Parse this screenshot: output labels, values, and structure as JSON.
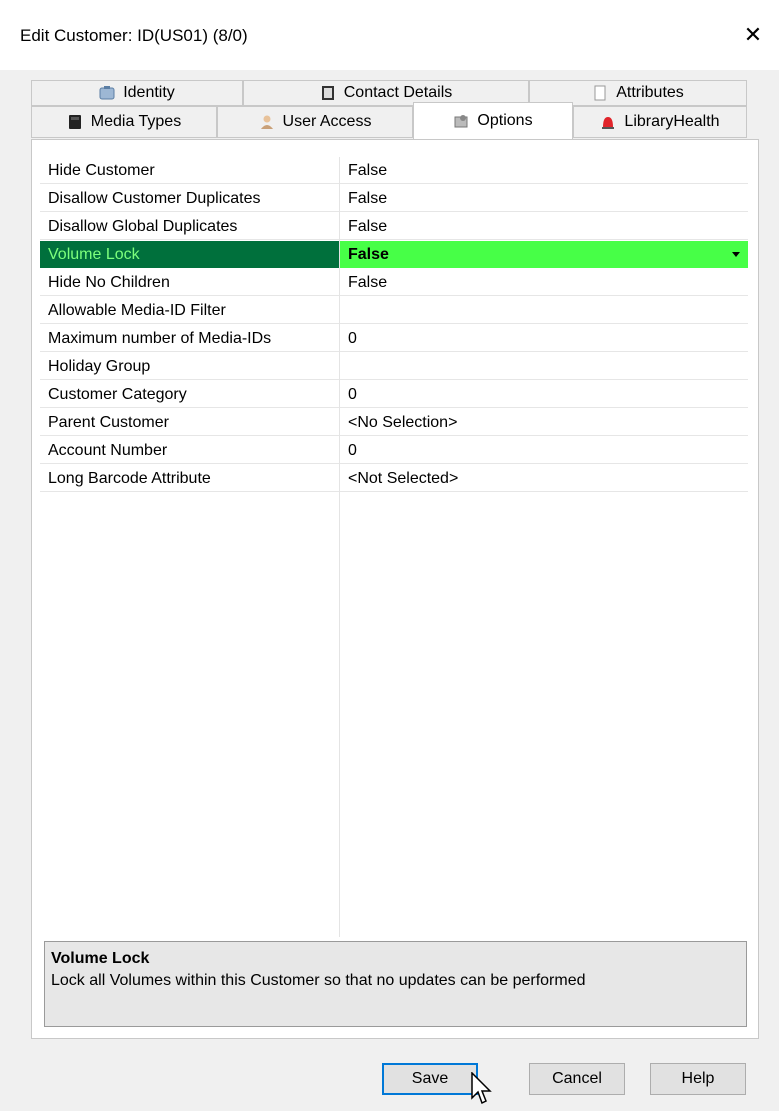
{
  "window": {
    "title": "Edit Customer: ID(US01) (8/0)",
    "close_glyph": "✕"
  },
  "tabs": {
    "row1": [
      {
        "label": "Identity",
        "icon": "identity-card-icon"
      },
      {
        "label": "Contact Details",
        "icon": "address-book-icon"
      },
      {
        "label": "Attributes",
        "icon": "attributes-icon"
      }
    ],
    "row2": [
      {
        "label": "Media Types",
        "icon": "media-cartridge-icon"
      },
      {
        "label": "User Access",
        "icon": "user-icon"
      },
      {
        "label": "Options",
        "icon": "options-icon",
        "active": true
      },
      {
        "label": "LibraryHealth",
        "icon": "alarm-light-icon"
      }
    ]
  },
  "properties": [
    {
      "name": "Hide Customer",
      "value": "False"
    },
    {
      "name": "Disallow Customer Duplicates",
      "value": "False"
    },
    {
      "name": "Disallow Global Duplicates",
      "value": "False"
    },
    {
      "name": "Volume Lock",
      "value": "False",
      "selected": true
    },
    {
      "name": "Hide No Children",
      "value": "False"
    },
    {
      "name": "Allowable Media-ID Filter",
      "value": ""
    },
    {
      "name": "Maximum number of Media-IDs",
      "value": "0"
    },
    {
      "name": "Holiday Group",
      "value": ""
    },
    {
      "name": "Customer Category",
      "value": "0"
    },
    {
      "name": "Parent Customer",
      "value": "<No Selection>"
    },
    {
      "name": "Account Number",
      "value": "0"
    },
    {
      "name": "Long Barcode Attribute",
      "value": "<Not Selected>"
    }
  ],
  "description": {
    "title": "Volume Lock",
    "text": "Lock all Volumes within this Customer so that no updates can be performed"
  },
  "buttons": {
    "save": "Save",
    "cancel": "Cancel",
    "help": "Help"
  },
  "colors": {
    "selected_name_bg": "#00703c",
    "selected_name_fg": "#7cff7c",
    "selected_value_bg": "#47ff47",
    "primary_button_border": "#0078d7"
  }
}
